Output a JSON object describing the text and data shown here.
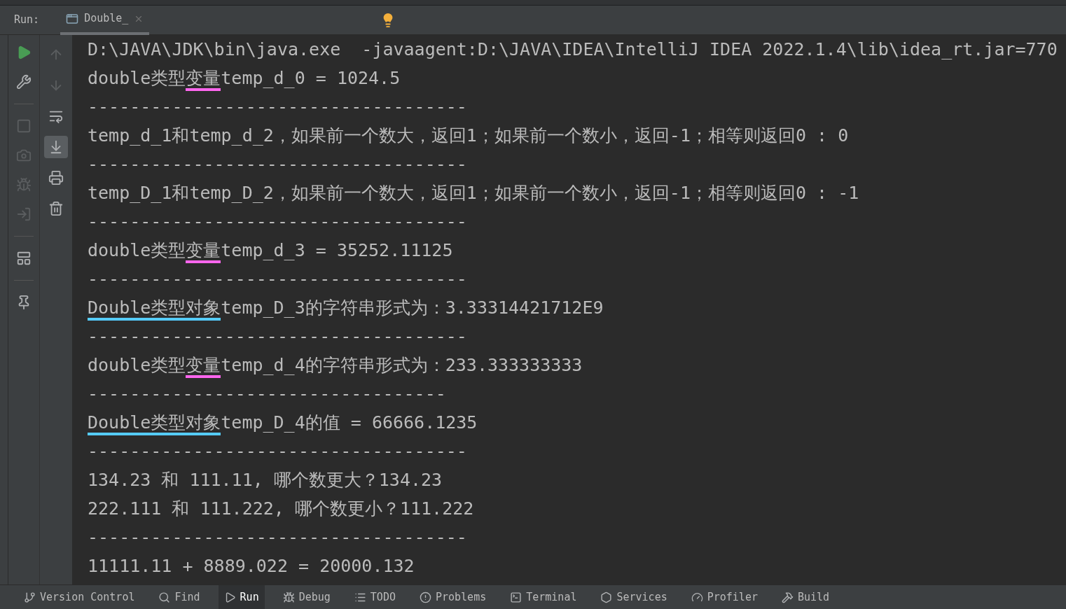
{
  "run_panel": {
    "label": "Run:",
    "tabs": [
      {
        "label": "Double_",
        "selected": true
      }
    ]
  },
  "left_toolbar": [
    {
      "kind": "run",
      "disabled": false
    },
    {
      "kind": "wrench",
      "disabled": false
    },
    {
      "kind": "separator"
    },
    {
      "kind": "stop",
      "disabled": true
    },
    {
      "kind": "camera",
      "disabled": true
    },
    {
      "kind": "bug",
      "disabled": true
    },
    {
      "kind": "login",
      "disabled": true
    },
    {
      "kind": "separator"
    },
    {
      "kind": "layout",
      "disabled": false
    },
    {
      "kind": "separator"
    },
    {
      "kind": "pin",
      "disabled": false
    }
  ],
  "right_toolbar": [
    {
      "kind": "up",
      "selected": false,
      "disabled": true
    },
    {
      "kind": "down",
      "selected": false,
      "disabled": true
    },
    {
      "kind": "wrap",
      "selected": false,
      "disabled": false
    },
    {
      "kind": "scroll_end",
      "selected": true,
      "disabled": false
    },
    {
      "kind": "print",
      "selected": false,
      "disabled": false
    },
    {
      "kind": "trash",
      "selected": false,
      "disabled": false
    }
  ],
  "console": [
    {
      "parts": [
        {
          "text": "D:\\JAVA\\JDK\\bin\\java.exe  -javaagent:D:\\JAVA\\IDEA\\IntelliJ IDEA 2022.1.4\\lib\\idea_rt.jar=770"
        }
      ]
    },
    {
      "parts": [
        {
          "text": "double类型"
        },
        {
          "text": "变量",
          "color": "#ff66ee"
        },
        {
          "text": "temp_d_0 = 1024.5"
        }
      ]
    },
    {
      "parts": [
        {
          "text": "------------------------------------"
        }
      ]
    },
    {
      "parts": [
        {
          "text": "temp_d_1和temp_d_2，如果前一个数大，返回1；如果前一个数小，返回-1；相等则返回0 : 0"
        }
      ]
    },
    {
      "parts": [
        {
          "text": "------------------------------------"
        }
      ]
    },
    {
      "parts": [
        {
          "text": "temp_D_1和temp_D_2，如果前一个数大，返回1；如果前一个数小，返回-1；相等则返回0 : -1"
        }
      ]
    },
    {
      "parts": [
        {
          "text": "------------------------------------"
        }
      ]
    },
    {
      "parts": [
        {
          "text": "double类型"
        },
        {
          "text": "变量",
          "color": "#ff66ee"
        },
        {
          "text": "temp_d_3 = 35252.11125"
        }
      ]
    },
    {
      "parts": [
        {
          "text": "------------------------------------"
        }
      ]
    },
    {
      "parts": [
        {
          "text": "Double类型对象",
          "color": "#55ccff"
        },
        {
          "text": "temp_D_3的字符串形式为：3.33314421712E9"
        }
      ]
    },
    {
      "parts": [
        {
          "text": "------------------------------------"
        }
      ]
    },
    {
      "parts": [
        {
          "text": "double类型"
        },
        {
          "text": "变量",
          "color": "#ff66ee"
        },
        {
          "text": "temp_d_4的字符串形式为：233.333333333"
        }
      ]
    },
    {
      "parts": [
        {
          "text": "----------------------------------"
        }
      ]
    },
    {
      "parts": [
        {
          "text": "Double类型对象",
          "color": "#55ccff"
        },
        {
          "text": "temp_D_4的值 = 66666.1235"
        }
      ]
    },
    {
      "parts": [
        {
          "text": "------------------------------------"
        }
      ]
    },
    {
      "parts": [
        {
          "text": "134.23 和 111.11, 哪个数更大？134.23"
        }
      ]
    },
    {
      "parts": [
        {
          "text": "222.111 和 111.222, 哪个数更小？111.222"
        }
      ]
    },
    {
      "parts": [
        {
          "text": "------------------------------------"
        }
      ]
    },
    {
      "parts": [
        {
          "text": "11111.11 + 8889.022 = 20000.132"
        }
      ]
    }
  ],
  "bottom_tabs": [
    {
      "kind": "vcs",
      "label": "Version Control",
      "selected": false
    },
    {
      "kind": "find",
      "label": "Find",
      "selected": false
    },
    {
      "kind": "run",
      "label": "Run",
      "selected": true
    },
    {
      "kind": "debug",
      "label": "Debug",
      "selected": false
    },
    {
      "kind": "todo",
      "label": "TODO",
      "selected": false
    },
    {
      "kind": "problems",
      "label": "Problems",
      "selected": false
    },
    {
      "kind": "terminal",
      "label": "Terminal",
      "selected": false
    },
    {
      "kind": "services",
      "label": "Services",
      "selected": false
    },
    {
      "kind": "profiler",
      "label": "Profiler",
      "selected": false
    },
    {
      "kind": "build",
      "label": "Build",
      "selected": false
    }
  ]
}
